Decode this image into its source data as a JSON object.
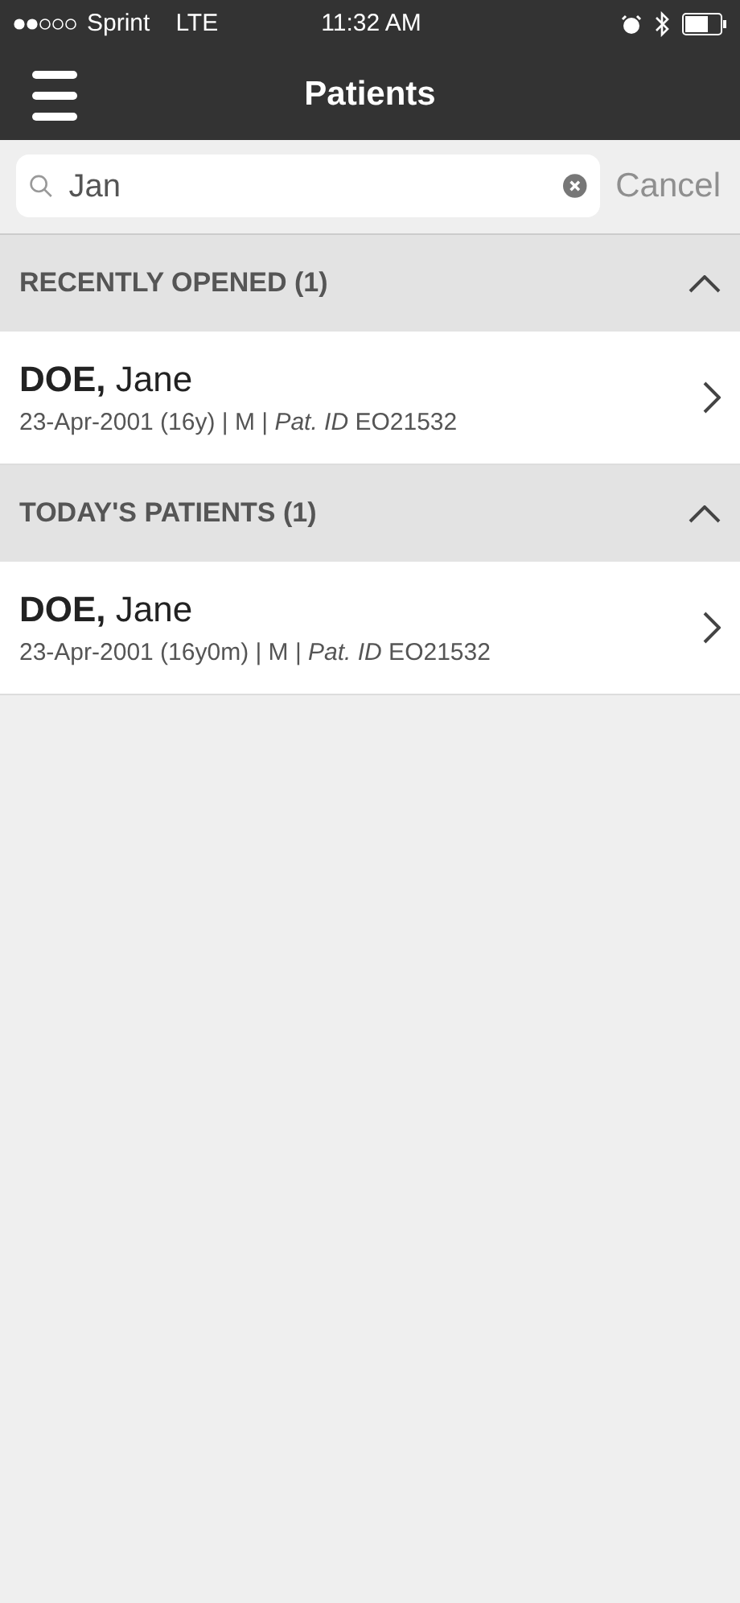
{
  "status_bar": {
    "carrier": "Sprint",
    "network": "LTE",
    "time": "11:32 AM"
  },
  "nav_bar": {
    "title": "Patients"
  },
  "search": {
    "value": "Jan",
    "cancel": "Cancel"
  },
  "sections": [
    {
      "title": "RECENTLY OPENED (1)",
      "expanded": true,
      "patients": [
        {
          "name": "**DOE,** Jane",
          "details": "23-Apr-2001 (16y) | M | *Pat. ID* EO21532"
        }
      ]
    },
    {
      "title": "TODAY'S PATIENTS (1)",
      "expanded": true,
      "patients": [
        {
          "name": "**DOE,** Jane",
          "details": "23-Apr-2001 (16y0m) | M | *Pat. ID* EO21532"
        }
      ]
    }
  ]
}
